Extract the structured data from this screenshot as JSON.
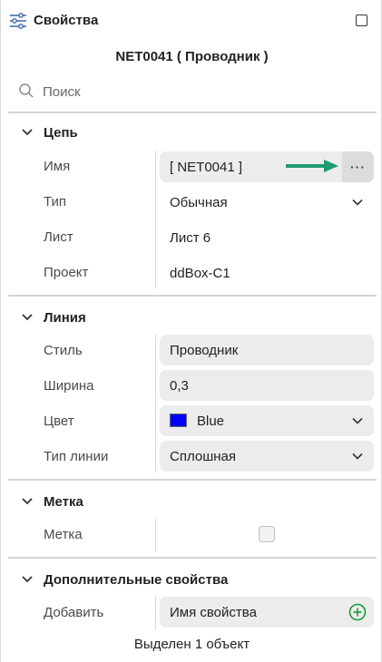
{
  "titlebar": {
    "title": "Свойства",
    "settings_icon": "sliders-icon",
    "window_icon": "maximize-icon"
  },
  "object_title": "NET0041 ( Проводник )",
  "search": {
    "placeholder": "Поиск"
  },
  "sections": {
    "circuit": {
      "label": "Цепь",
      "rows": {
        "name": {
          "label": "Имя",
          "value": "[ NET0041 ]",
          "more_label": "···"
        },
        "type": {
          "label": "Тип",
          "value": "Обычная"
        },
        "sheet": {
          "label": "Лист",
          "value": "Лист 6"
        },
        "project": {
          "label": "Проект",
          "value": "ddBox-C1"
        }
      }
    },
    "line": {
      "label": "Линия",
      "rows": {
        "style": {
          "label": "Стиль",
          "value": "Проводник"
        },
        "width": {
          "label": "Ширина",
          "value": "0,3"
        },
        "color": {
          "label": "Цвет",
          "value": "Blue",
          "swatch": "#0000ff"
        },
        "line_type": {
          "label": "Тип линии",
          "value": "Сплошная"
        }
      }
    },
    "mark": {
      "label": "Метка",
      "rows": {
        "mark": {
          "label": "Метка",
          "checked": false
        }
      }
    },
    "extra": {
      "label": "Дополнительные свойства",
      "rows": {
        "add": {
          "label": "Добавить",
          "placeholder": "Имя свойства"
        }
      }
    }
  },
  "status": "Выделен 1 объект",
  "colors": {
    "accent_arrow": "#1f9a73",
    "add_icon": "#1a9a3a",
    "field_bg": "#ececec"
  }
}
